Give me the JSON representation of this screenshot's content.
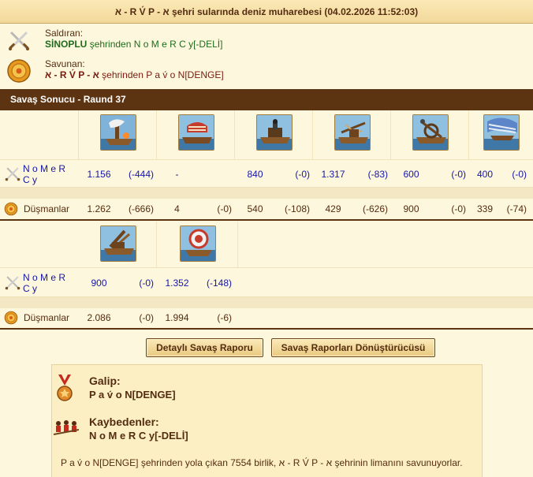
{
  "title": "א - R V́ P - א şehri sularında deniz muharebesi (04.02.2026 11:52:03)",
  "attacker": {
    "label": "Saldıran:",
    "city": "SİNOPLU",
    "rest": "şehrinden N o M e R C y[-DELİ]",
    "icon": "crossed-swords-icon"
  },
  "defender": {
    "label": "Savunan:",
    "city": "א - R V́ P - א",
    "rest": "şehrinden P a v́ o N[DENGE]",
    "icon": "round-shield-icon"
  },
  "round_title": "Savaş Sonucu - Raund 37",
  "side_us": {
    "name_line1": "N o M e R",
    "name_line2": "C y"
  },
  "side_enemy": {
    "name": "Düşmanlar"
  },
  "table1": {
    "units": [
      "fire-ship-icon",
      "ram-ship-icon",
      "mortar-ship-icon",
      "ballista-ship-icon",
      "catapult-ship-icon",
      "paddle-steamer-icon"
    ],
    "us": [
      {
        "count": "1.156",
        "loss": "(-444)"
      },
      {
        "count": "-",
        "loss": ""
      },
      {
        "count": "840",
        "loss": "(-0)"
      },
      {
        "count": "1.317",
        "loss": "(-83)"
      },
      {
        "count": "600",
        "loss": "(-0)"
      },
      {
        "count": "400",
        "loss": "(-0)"
      }
    ],
    "enemy": [
      {
        "count": "1.262",
        "loss": "(-666)"
      },
      {
        "count": "4",
        "loss": "(-0)"
      },
      {
        "count": "540",
        "loss": "(-108)"
      },
      {
        "count": "429",
        "loss": "(-626)"
      },
      {
        "count": "900",
        "loss": "(-0)"
      },
      {
        "count": "339",
        "loss": "(-74)"
      }
    ]
  },
  "table2": {
    "units": [
      "rocket-ship-icon",
      "diving-boat-icon"
    ],
    "us": [
      {
        "count": "900",
        "loss": "(-0)"
      },
      {
        "count": "1.352",
        "loss": "(-148)"
      }
    ],
    "enemy": [
      {
        "count": "2.086",
        "loss": "(-0)"
      },
      {
        "count": "1.994",
        "loss": "(-6)"
      }
    ]
  },
  "buttons": {
    "detailed_report": "Detaylı Savaş Raporu",
    "report_converter": "Savaş Raporları Dönüştürücüsü"
  },
  "result": {
    "winner_label": "Galip:",
    "winner_name": "P a v́ o N[DENGE]",
    "loser_label": "Kaybedenler:",
    "loser_name": "N o M e R C y[-DELİ]",
    "footer": "P a v́ o N[DENGE] şehrinden yola çıkan 7554 birlik, א - R V́ P - א şehrinin limanını savunuyorlar."
  },
  "colors": {
    "header_bar": "#5d3412",
    "attacker_text": "#1f6b1b",
    "defender_text": "#7a1a0f",
    "unit_numbers": "#1616a8"
  }
}
